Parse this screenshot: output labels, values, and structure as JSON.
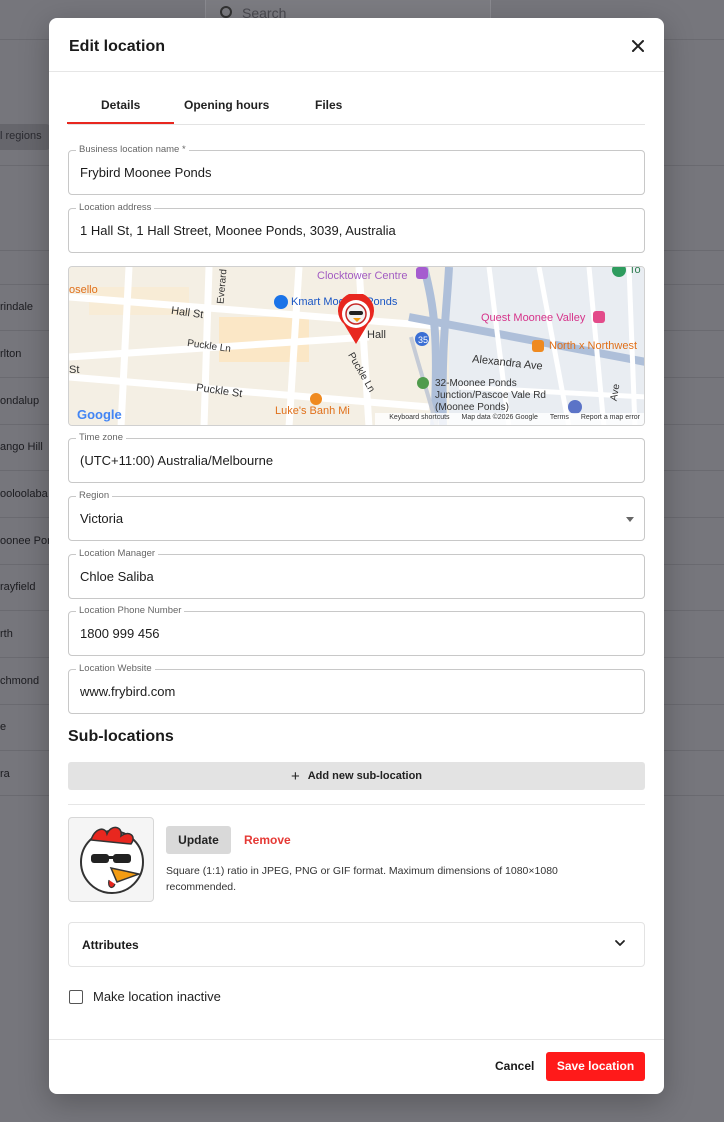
{
  "background": {
    "search_placeholder": "Search",
    "filter_pill": "l regions",
    "list_items": [
      "rindale",
      "rlton",
      "ondalup",
      "ango Hill",
      "ooloolaba",
      "oonee Pon",
      "rayfield",
      "rth",
      "chmond",
      "e",
      "ra"
    ]
  },
  "modal": {
    "title": "Edit location",
    "tabs": [
      {
        "label": "Details"
      },
      {
        "label": "Opening hours"
      },
      {
        "label": "Files"
      }
    ]
  },
  "fields": {
    "business_name": {
      "label": "Business location name *",
      "value": "Frybird Moonee Ponds"
    },
    "address": {
      "label": "Location address",
      "value": "1 Hall St, 1 Hall Street, Moonee Ponds, 3039, Australia"
    },
    "timezone": {
      "label": "Time zone",
      "value": "(UTC+11:00) Australia/Melbourne"
    },
    "region": {
      "label": "Region",
      "value": "Victoria"
    },
    "manager": {
      "label": "Location Manager",
      "value": "Chloe Saliba"
    },
    "phone": {
      "label": "Location Phone Number",
      "value": "1800 999 456"
    },
    "website": {
      "label": "Location Website",
      "value": "www.frybird.com"
    }
  },
  "map": {
    "labels": {
      "clocktower": "Clocktower Centre",
      "kmart": "Kmart Moonee Ponds",
      "quest": "Quest Moonee Valley",
      "northx": "North x Northwest",
      "alexandra": "Alexandra Ave",
      "hall": "Hall St",
      "puckle1": "Puckle Ln",
      "puckle2": "Puckle St",
      "puckle3": "Puckle Ln",
      "everard": "Everard",
      "rosello": "osello",
      "junction": "32-Moonee Ponds Junction/Pascoe Vale Rd (Moonee Ponds)",
      "lukes": "Luke's Banh Mi",
      "street_left": "St",
      "hall2": "Hall",
      "ave": "Ave",
      "num35": "35",
      "to": "To",
      "google": "Google"
    },
    "footer": [
      "Keyboard shortcuts",
      "Map data ©2026 Google",
      "Terms",
      "Report a map error"
    ]
  },
  "sublocations": {
    "title": "Sub-locations",
    "add_label": "Add new sub-location"
  },
  "image": {
    "update_label": "Update",
    "remove_label": "Remove",
    "hint": "Square (1:1) ratio in JPEG, PNG or GIF format. Maximum dimensions of 1080×1080 recommended."
  },
  "attributes": {
    "label": "Attributes"
  },
  "inactive": {
    "label": "Make location inactive"
  },
  "footer": {
    "cancel_label": "Cancel",
    "save_label": "Save location"
  },
  "colors": {
    "accent": "#ff1a1a",
    "remove": "#e53935",
    "tab_underline": "#e8271f"
  }
}
